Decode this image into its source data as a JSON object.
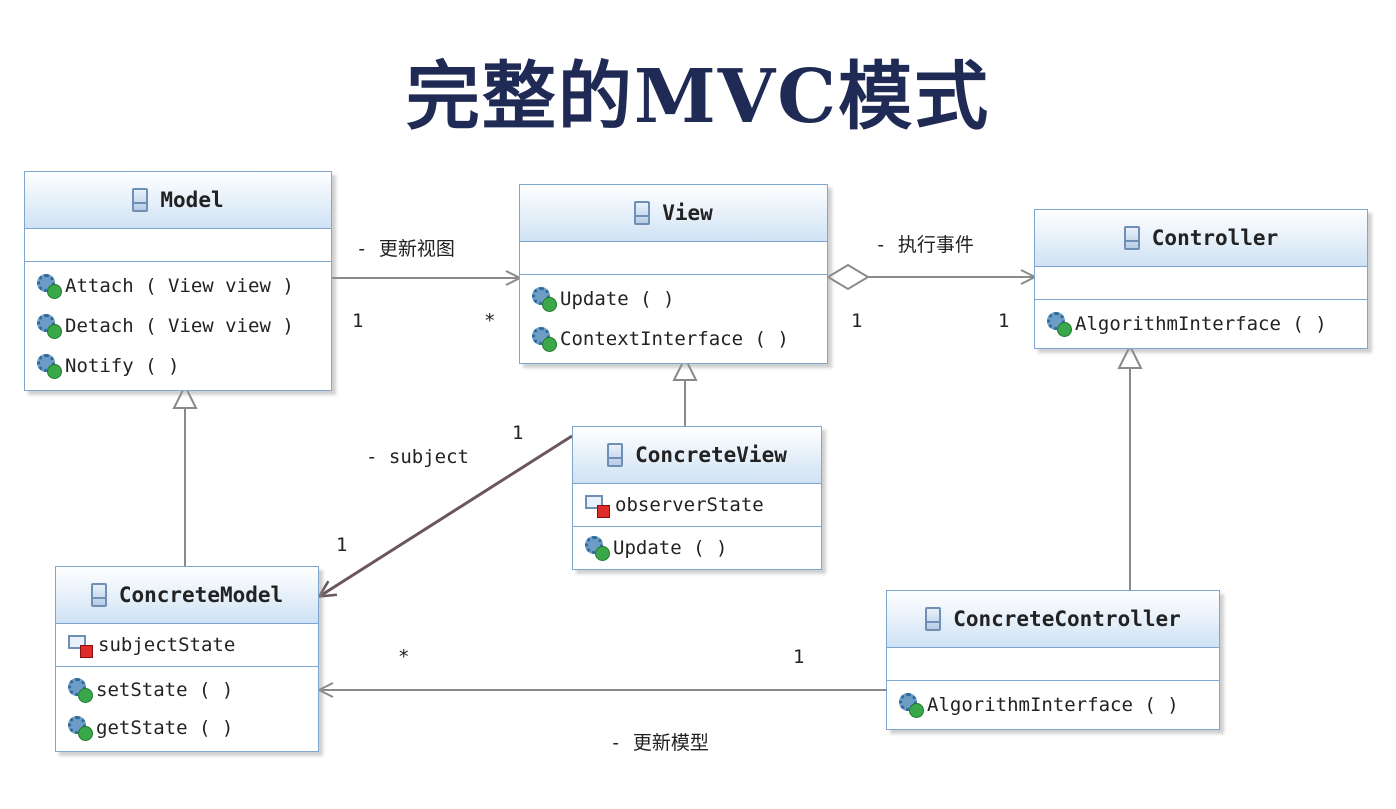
{
  "title": "完整的MVC模式",
  "classes": {
    "model": {
      "name": "Model",
      "methods": [
        "Attach ( View view )",
        "Detach ( View view )",
        "Notify ( )"
      ]
    },
    "view": {
      "name": "View",
      "methods": [
        "Update ( )",
        "ContextInterface ( )"
      ]
    },
    "controller": {
      "name": "Controller",
      "methods": [
        "AlgorithmInterface ( )"
      ]
    },
    "concrete_view": {
      "name": "ConcreteView",
      "fields": [
        "observerState"
      ],
      "methods": [
        "Update ( )"
      ]
    },
    "concrete_model": {
      "name": "ConcreteModel",
      "fields": [
        "subjectState"
      ],
      "methods": [
        "setState ( )",
        "getState ( )"
      ]
    },
    "concrete_controller": {
      "name": "ConcreteController",
      "methods": [
        "AlgorithmInterface ( )"
      ]
    }
  },
  "associations": {
    "model_view": {
      "label": "- 更新视图",
      "source_mult": "1",
      "target_mult": "*"
    },
    "view_controller": {
      "label": "- 执行事件",
      "source_mult": "1",
      "target_mult": "1"
    },
    "concreteview_concretemodel": {
      "label": "- subject",
      "source_mult": "1",
      "target_mult": "1"
    },
    "concretecontroller_concretemodel": {
      "label": "- 更新模型",
      "source_mult": "1",
      "target_mult": "*"
    }
  },
  "icons": {
    "class": "class-icon",
    "method": "public-method-icon",
    "field": "private-field-icon"
  },
  "colors": {
    "title": "#1f2a55",
    "class_border": "#7fa6cf",
    "header_gradient_end": "#cfe2f4",
    "line": "#8a8a8a",
    "subject_line": "#6b5560"
  }
}
